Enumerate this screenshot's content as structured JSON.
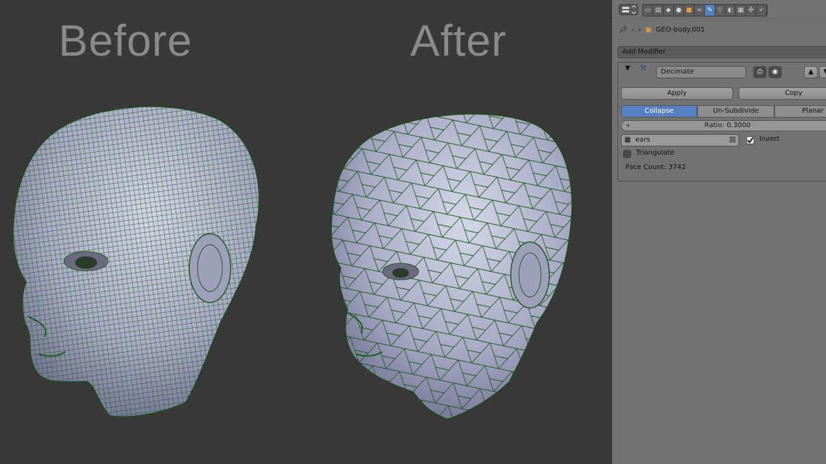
{
  "viewport": {
    "before_label": "Before",
    "after_label": "After"
  },
  "properties": {
    "header_icons": [
      "render-icon",
      "render-layers-icon",
      "scene-icon",
      "world-icon",
      "object-icon",
      "constraints-icon",
      "modifiers-icon",
      "data-icon",
      "material-icon",
      "texture-icon",
      "particles-icon",
      "physics-icon"
    ],
    "object_name": "GEO-body.001",
    "add_modifier": "Add Modifier",
    "modifier": {
      "name": "Decimate",
      "apply": "Apply",
      "copy": "Copy",
      "modes": [
        "Collapse",
        "Un-Subdivide",
        "Planar"
      ],
      "active_mode": "Collapse",
      "ratio": "Ratio: 0.3000",
      "vertex_group": "ears",
      "invert": "Invert",
      "invert_checked": true,
      "triangulate": "Triangulate",
      "triangulate_checked": false,
      "face_count": "Face Count: 3742"
    }
  },
  "colors": {
    "viewport_bg": "#393939",
    "panel_bg": "#727272",
    "accent": "#5680c2",
    "wire": "#1e5a1e"
  }
}
